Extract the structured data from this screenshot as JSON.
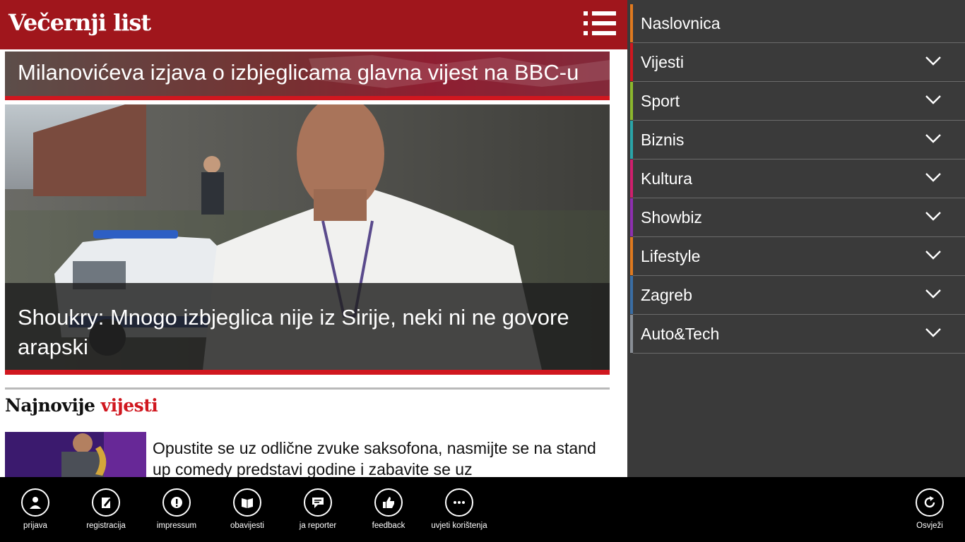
{
  "app": {
    "title": "Večernji list"
  },
  "colors": {
    "brand": "#a0161c",
    "accent": "#d0171f",
    "nav_bg": "#3a3a3a",
    "appbar_bg": "#000000"
  },
  "main": {
    "top_headline": "Milanovićeva izjava o izbjeglicama glavna vijest na BBC-u",
    "hero_headline": "Shoukry: Mnogo izbjeglica nije iz Sirije, neki ni ne govore arapski",
    "section_title_prefix": "Najnovije",
    "section_title_accent": "vijesti",
    "news_item_text": "Opustite se uz odlične zvuke saksofona, nasmijte se na stand up comedy predstavi godine i zabavite se uz"
  },
  "nav": {
    "items": [
      {
        "label": "Naslovnica",
        "color": "#e07a1f",
        "expandable": false
      },
      {
        "label": "Vijesti",
        "color": "#d0171f",
        "expandable": true
      },
      {
        "label": "Sport",
        "color": "#8cb82d",
        "expandable": true
      },
      {
        "label": "Biznis",
        "color": "#2aa5a9",
        "expandable": true
      },
      {
        "label": "Kultura",
        "color": "#d01f6d",
        "expandable": true
      },
      {
        "label": "Showbiz",
        "color": "#8e2fb0",
        "expandable": true
      },
      {
        "label": "Lifestyle",
        "color": "#e07a1f",
        "expandable": true
      },
      {
        "label": "Zagreb",
        "color": "#3a6ea5",
        "expandable": true
      },
      {
        "label": "Auto&Tech",
        "color": "#8a8f96",
        "expandable": true
      }
    ]
  },
  "appbar": {
    "buttons": [
      {
        "label": "prijava",
        "icon": "user-icon"
      },
      {
        "label": "registracija",
        "icon": "edit-icon"
      },
      {
        "label": "impressum",
        "icon": "info-alert-icon"
      },
      {
        "label": "obavijesti",
        "icon": "book-icon"
      },
      {
        "label": "ja reporter",
        "icon": "chat-icon"
      },
      {
        "label": "feedback",
        "icon": "thumbs-up-icon"
      },
      {
        "label": "uvjeti korištenja",
        "icon": "more-icon"
      }
    ],
    "refresh_label": "Osvježi",
    "refresh_icon": "refresh-icon"
  }
}
